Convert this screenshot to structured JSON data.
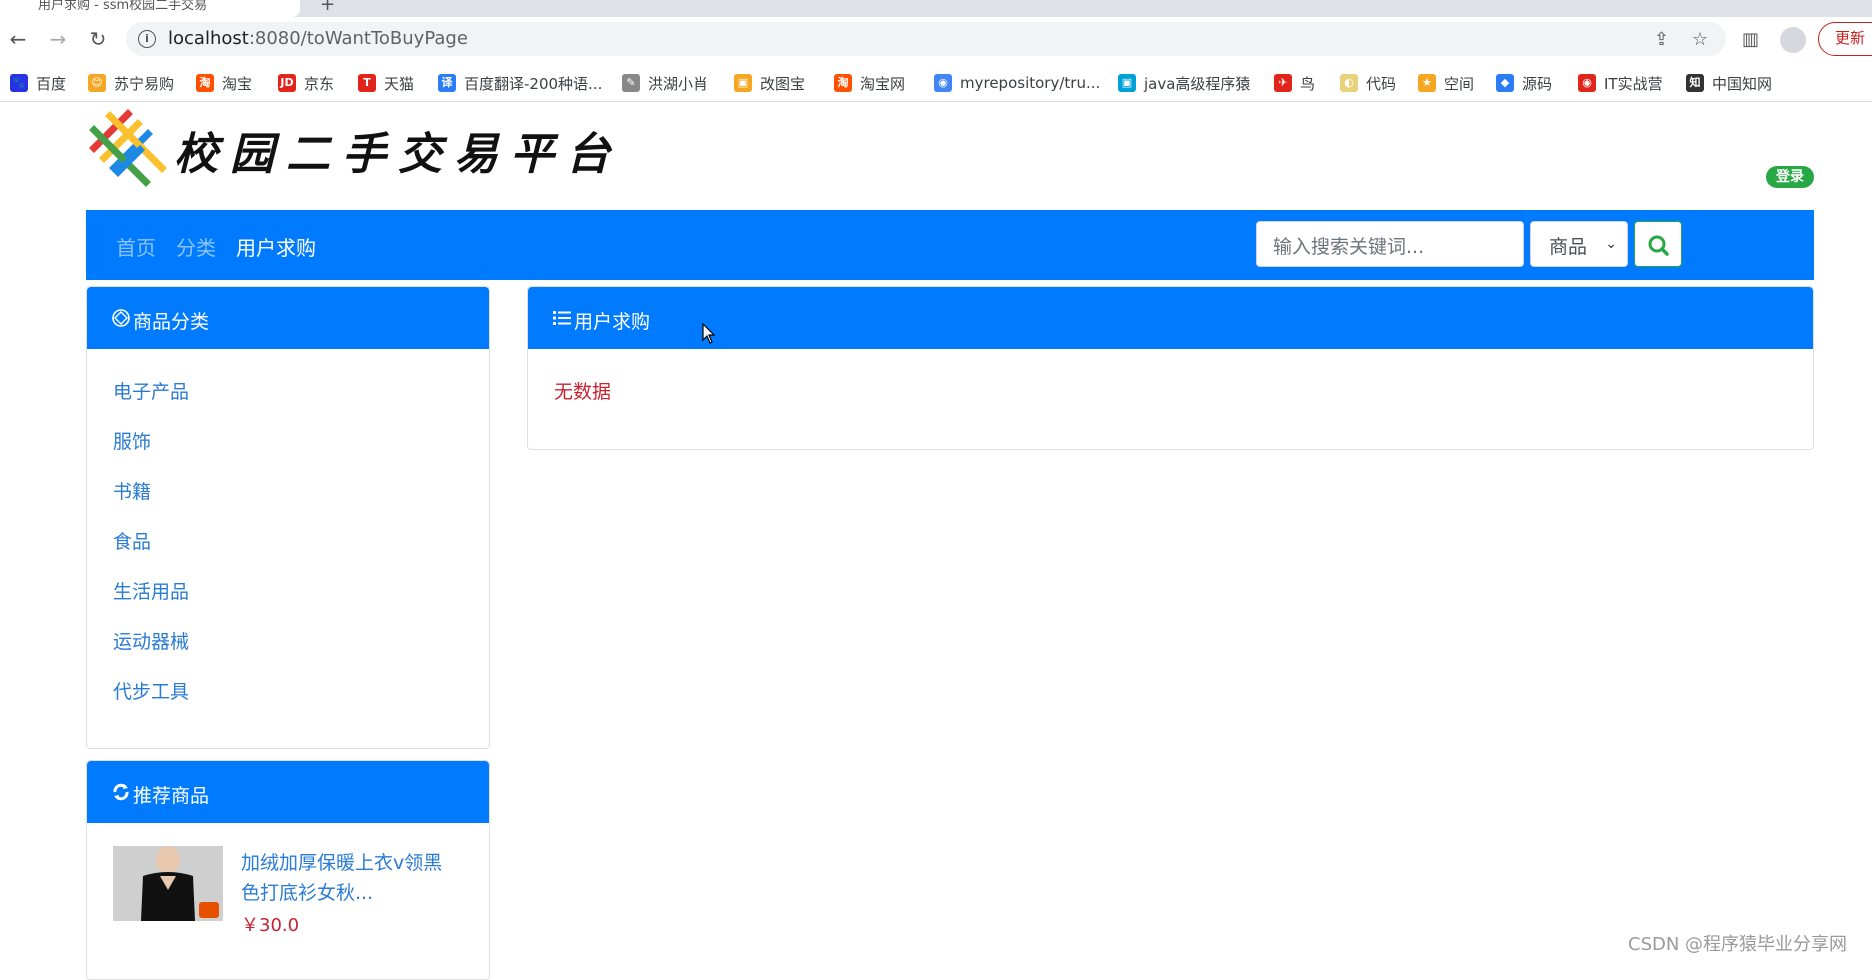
{
  "browser": {
    "tab_title": "用户求购 - ssm校园二手交易",
    "url_host": "localhost",
    "url_rest": ":8080/toWantToBuyPage",
    "update_label": "更新"
  },
  "bookmarks": [
    {
      "label": "百度",
      "icon": "paw-icon",
      "color": "#2932e1",
      "glyph": "🐾"
    },
    {
      "label": "苏宁易购",
      "icon": "suning-icon",
      "color": "#f5a623",
      "glyph": "😊"
    },
    {
      "label": "淘宝",
      "icon": "taobao-icon",
      "color": "#ff5000",
      "glyph": "淘"
    },
    {
      "label": "京东",
      "icon": "jd-icon",
      "color": "#e1251b",
      "glyph": "JD"
    },
    {
      "label": "天猫",
      "icon": "tmall-icon",
      "color": "#e1251b",
      "glyph": "T"
    },
    {
      "label": "百度翻译-200种语...",
      "icon": "translate-icon",
      "color": "#2b7df6",
      "glyph": "译"
    },
    {
      "label": "洪湖小肖",
      "icon": "bird-icon",
      "color": "#888888",
      "glyph": "✎"
    },
    {
      "label": "改图宝",
      "icon": "gaitubao-icon",
      "color": "#f5a623",
      "glyph": "▣"
    },
    {
      "label": "淘宝网",
      "icon": "taobao-icon",
      "color": "#ff5000",
      "glyph": "淘"
    },
    {
      "label": "myrepository/tru...",
      "icon": "chrome-icon",
      "color": "#4285f4",
      "glyph": "◉"
    },
    {
      "label": "java高级程序猿",
      "icon": "bilibili-icon",
      "color": "#00a1d6",
      "glyph": "▣"
    },
    {
      "label": "鸟",
      "icon": "bird-icon",
      "color": "#e1251b",
      "glyph": "✈"
    },
    {
      "label": "代码",
      "icon": "code-icon",
      "color": "#e8d27a",
      "glyph": "◐"
    },
    {
      "label": "空间",
      "icon": "qzone-icon",
      "color": "#f5a623",
      "glyph": "★"
    },
    {
      "label": "源码",
      "icon": "source-icon",
      "color": "#2b7df6",
      "glyph": "◆"
    },
    {
      "label": "IT实战营",
      "icon": "itcamp-icon",
      "color": "#e1251b",
      "glyph": "◉"
    },
    {
      "label": "中国知网",
      "icon": "cnki-icon",
      "color": "#333333",
      "glyph": "知"
    }
  ],
  "site": {
    "title": "校园二手交易平台",
    "login_label": "登录"
  },
  "nav": {
    "links": [
      {
        "label": "首页",
        "active": false
      },
      {
        "label": "分类",
        "active": false
      },
      {
        "label": "用户求购",
        "active": true
      }
    ],
    "search_placeholder": "输入搜索关键词...",
    "search_type": "商品"
  },
  "sidebar": {
    "category_title": "商品分类",
    "categories": [
      "电子产品",
      "服饰",
      "书籍",
      "食品",
      "生活用品",
      "运动器械",
      "代步工具"
    ],
    "recommend_title": "推荐商品",
    "recommend_items": [
      {
        "name": "加绒加厚保暖上衣v领黑色打底衫女秋...",
        "price": "￥30.0"
      }
    ]
  },
  "main": {
    "panel_title": "用户求购",
    "empty_text": "无数据"
  },
  "watermark": "CSDN @程序猿毕业分享网",
  "colors": {
    "primary": "#007bff",
    "success": "#28a745",
    "danger": "#c82333",
    "link": "#2a7bd4"
  }
}
